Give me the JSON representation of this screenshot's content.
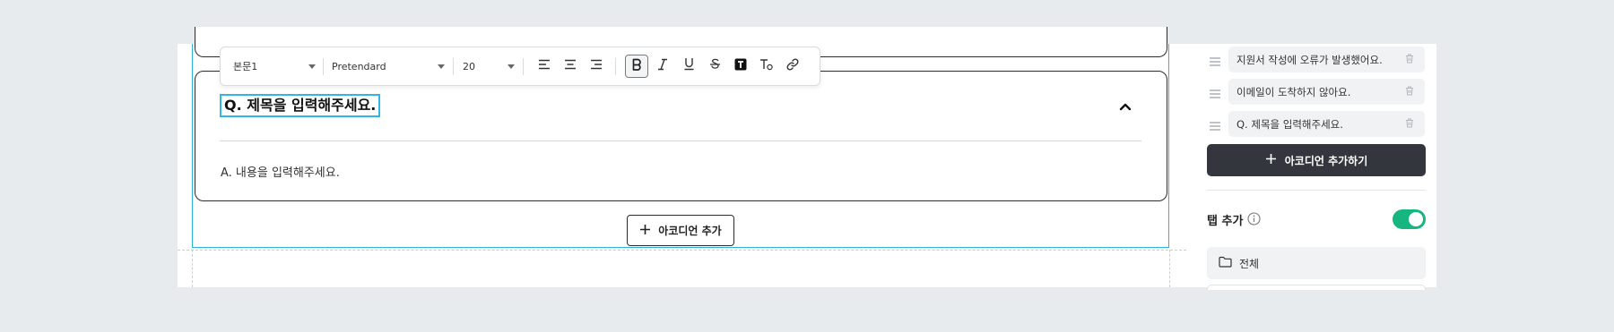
{
  "toolbar": {
    "text_style": "본문1",
    "font_family": "Pretendard",
    "font_size": "20",
    "buttons": [
      "align-left",
      "align-center",
      "align-right",
      "bold",
      "italic",
      "underline",
      "strikethrough",
      "text-background",
      "clear-format",
      "link"
    ],
    "active_button": "bold"
  },
  "accordion": {
    "title": "Q. 제목을 입력해주세요.",
    "body": "A. 내용을 입력해주세요.",
    "expanded": true
  },
  "canvas": {
    "add_accordion_label": "아코디언 추가"
  },
  "panel": {
    "items": [
      {
        "label": "지원서 작성에 오류가 발생했어요."
      },
      {
        "label": "이메일이 도착하지 않아요."
      },
      {
        "label": "Q. 제목을 입력해주세요."
      }
    ],
    "add_button_label": "아코디언 추가하기",
    "tab_label": "탭 추가",
    "tab_toggle_on": true,
    "tab_items": [
      {
        "label": "전체"
      }
    ]
  },
  "colors": {
    "selection": "#33b5e5",
    "toggle_on": "#17b57f",
    "dark_button": "#33373d"
  }
}
